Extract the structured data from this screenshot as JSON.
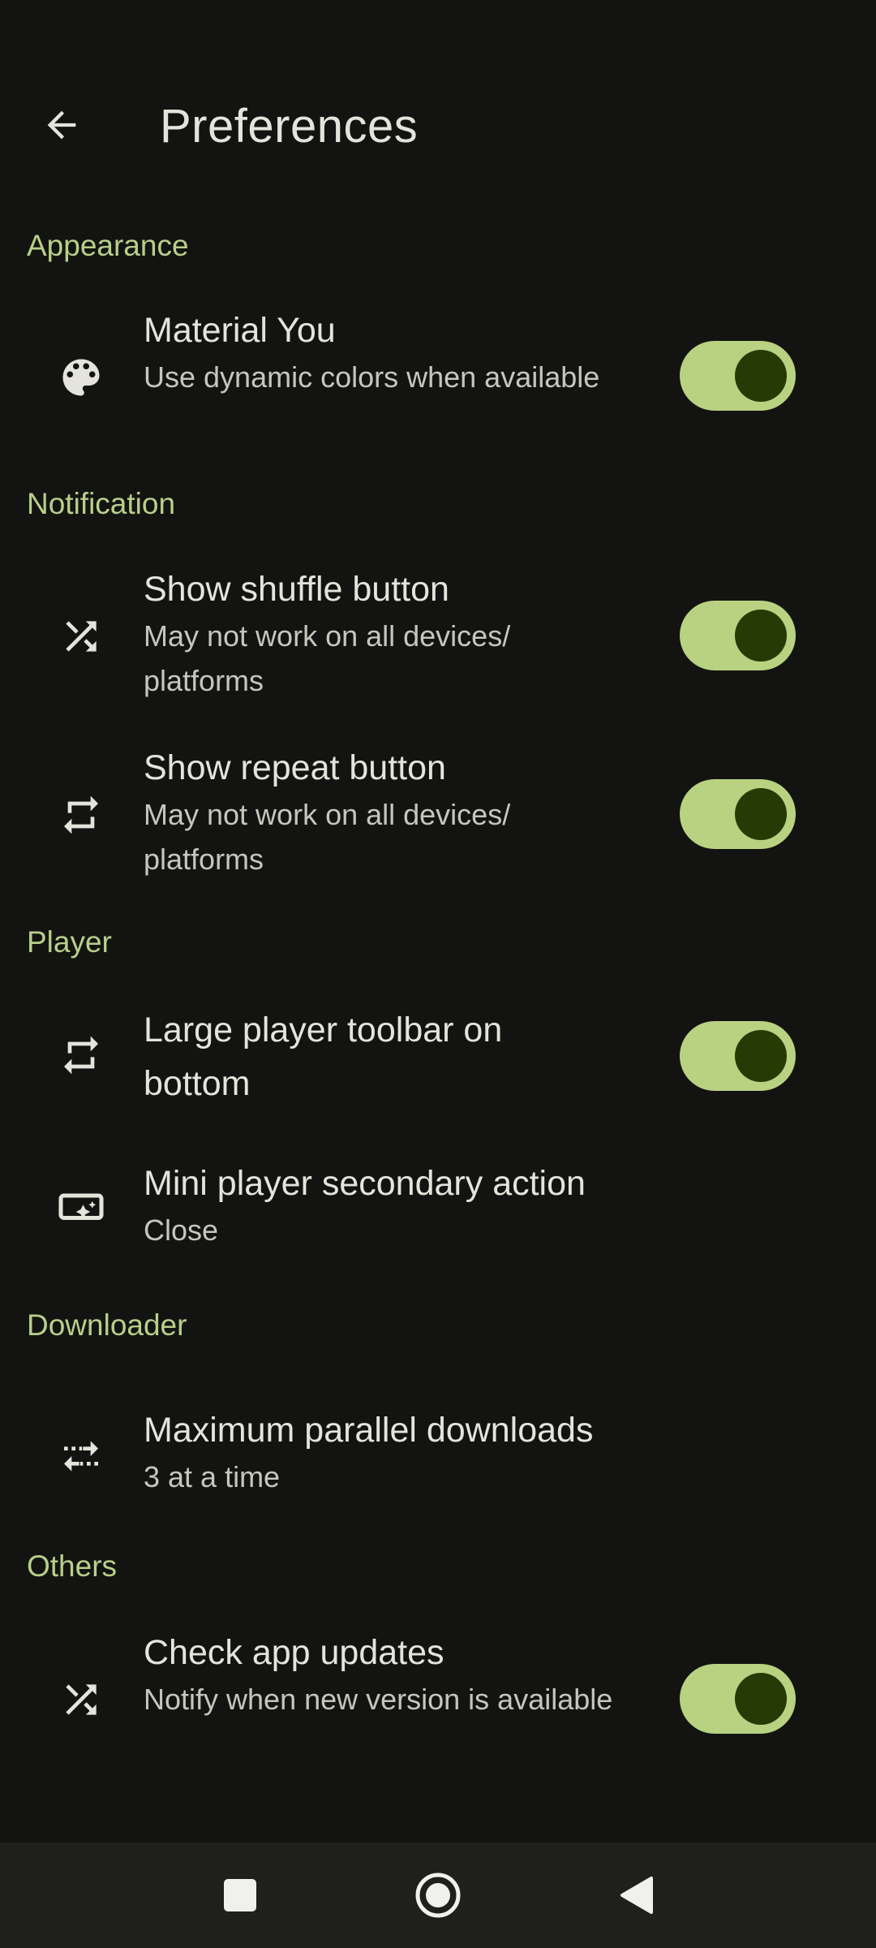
{
  "header": {
    "title": "Preferences",
    "back_icon": "arrow-back-icon"
  },
  "sections": {
    "appearance": "Appearance",
    "notification": "Notification",
    "player": "Player",
    "downloader": "Downloader",
    "others": "Others"
  },
  "items": {
    "material_you": {
      "title": "Material You",
      "subtitle": "Use dynamic colors when available",
      "icon": "palette-icon",
      "toggle": true
    },
    "show_shuffle": {
      "title": "Show shuffle button",
      "subtitle": "May not work on all devices/ platforms",
      "icon": "shuffle-icon",
      "toggle": true
    },
    "show_repeat": {
      "title": "Show repeat button",
      "subtitle": "May not work on all devices/ platforms",
      "icon": "repeat-icon",
      "toggle": true
    },
    "large_toolbar": {
      "title": "Large player toolbar on bottom",
      "icon": "repeat-icon",
      "toggle": true
    },
    "mini_player_action": {
      "title": "Mini player secondary action",
      "subtitle": "Close",
      "icon": "mini-player-icon"
    },
    "parallel_downloads": {
      "title": "Maximum parallel downloads",
      "subtitle": "3 at a time",
      "icon": "parallel-arrows-icon"
    },
    "check_updates": {
      "title": "Check app updates",
      "subtitle": "Notify when new version is available",
      "icon": "shuffle-icon",
      "toggle": true
    }
  },
  "navbar": {
    "recent_icon": "square-icon",
    "home_icon": "circle-icon",
    "back_icon": "triangle-back-icon"
  },
  "colors": {
    "background": "#131411",
    "accent": "#b8cf8a",
    "switch_track": "#b8d281",
    "switch_thumb": "#243b05"
  }
}
